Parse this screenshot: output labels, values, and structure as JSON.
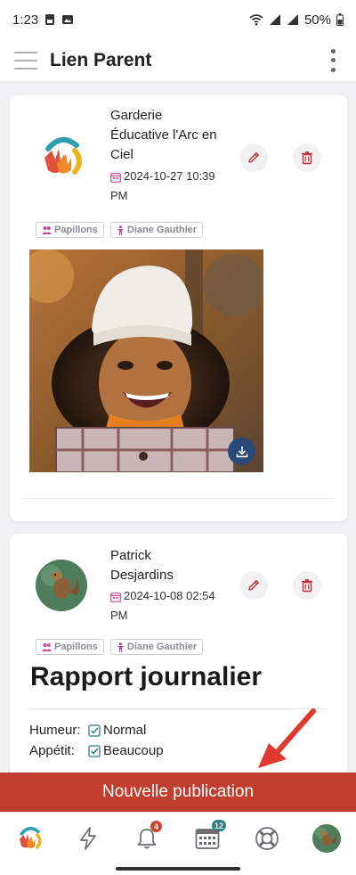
{
  "status_bar": {
    "time": "1:23",
    "battery": "50%"
  },
  "app_bar": {
    "title": "Lien Parent"
  },
  "posts": [
    {
      "poster": "Garderie Éducative l'Arc en Ciel",
      "poster_lines": [
        "Garderie",
        "Éducative l'Arc en",
        "Ciel"
      ],
      "date_lines": [
        "2024-10-27 10:39",
        "PM"
      ],
      "tags": [
        {
          "icon": "group-icon",
          "label": "Papillons"
        },
        {
          "icon": "child-icon",
          "label": "Diane Gauthier"
        }
      ]
    },
    {
      "poster": "Patrick Desjardins",
      "poster_lines": [
        "Patrick",
        "Desjardins"
      ],
      "date_lines": [
        "2024-10-08 02:54",
        "PM"
      ],
      "tags": [
        {
          "icon": "group-icon",
          "label": "Papillons"
        },
        {
          "icon": "child-icon",
          "label": "Diane Gauthier"
        }
      ],
      "report": {
        "title": "Rapport journalier",
        "rows": [
          {
            "label": "Humeur:",
            "value": "Normal"
          },
          {
            "label": "Appétit:",
            "value": "Beaucoup"
          }
        ]
      }
    }
  ],
  "new_post_label": "Nouvelle publication",
  "bottom_nav": [
    {
      "name": "home",
      "icon": "logo-icon",
      "badge": ""
    },
    {
      "name": "activity",
      "icon": "lightning-icon",
      "badge": ""
    },
    {
      "name": "notifications",
      "icon": "bell-icon",
      "badge": "4"
    },
    {
      "name": "calendar",
      "icon": "calendar-icon",
      "badge": "12"
    },
    {
      "name": "help",
      "icon": "lifebuoy-icon",
      "badge": ""
    },
    {
      "name": "profile",
      "icon": "avatar-icon",
      "badge": ""
    }
  ],
  "colors": {
    "accent_red": "#c13e2f",
    "icon_red": "#c0303a",
    "download_blue": "#2c4a78",
    "calendar_pink": "#c44a9a",
    "badge_red": "#d2452f",
    "badge_teal": "#2f7d86"
  }
}
